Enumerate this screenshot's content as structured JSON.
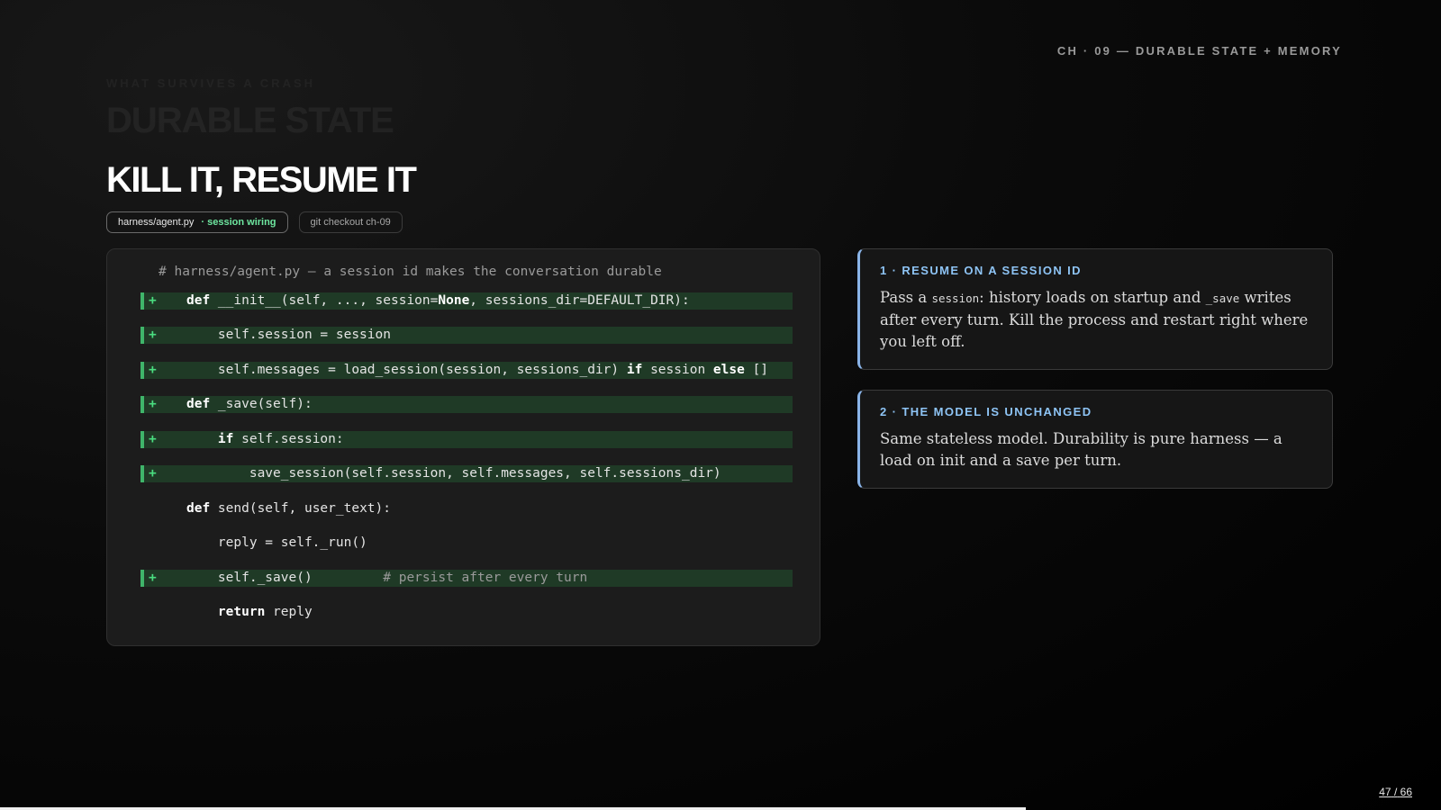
{
  "header": {
    "chapter": "CH · 09 — DURABLE STATE + MEMORY"
  },
  "background_slide": {
    "eyebrow": "WHAT SURVIVES A CRASH",
    "title": "DURABLE STATE"
  },
  "slide": {
    "title": "KILL IT, RESUME IT",
    "chips": {
      "file": "harness/agent.py",
      "file_note": "· session wiring",
      "git": "git checkout ch-09"
    }
  },
  "code": {
    "comment": "# harness/agent.py — a session id makes the conversation durable",
    "lines": [
      {
        "added": true,
        "marker": "+",
        "indent": "",
        "kw": "def",
        "text": " __init__(self, ..., session=",
        "kw2": "None",
        "rest": ", sessions_dir=DEFAULT_DIR):"
      },
      {
        "added": true,
        "marker": "+",
        "indent": "    ",
        "text": "self.session = session"
      },
      {
        "added": true,
        "marker": "+",
        "indent": "    ",
        "text": "self.messages = load_session(session, sessions_dir) ",
        "kw": "if",
        "mid": " session ",
        "kw2": "else",
        "rest": " []"
      },
      {
        "added": true,
        "marker": "+",
        "indent": "",
        "kw": "def",
        "text": " _save(self):"
      },
      {
        "added": true,
        "marker": "+",
        "indent": "    ",
        "kw": "if",
        "text": " self.session:"
      },
      {
        "added": true,
        "marker": "+",
        "indent": "        ",
        "text": "save_session(self.session, self.messages, self.sessions_dir)"
      },
      {
        "added": false,
        "marker": "",
        "indent": "",
        "kw": "def",
        "text": " send(self, user_text):"
      },
      {
        "added": false,
        "marker": "",
        "indent": "    ",
        "text": "reply = self._run()"
      },
      {
        "added": true,
        "marker": "+",
        "indent": "    ",
        "text": "self._save()         ",
        "comment": "# persist after every turn"
      },
      {
        "added": false,
        "marker": "",
        "indent": "    ",
        "kw": "return",
        "text": " reply"
      }
    ]
  },
  "cards": [
    {
      "label": "1 · RESUME ON A SESSION ID",
      "body_before": "Pass a ",
      "body_code": "session",
      "body_middle": ": history loads on startup and ",
      "body_code2": "_save",
      "body_after": " writes after every turn. Kill the process and restart right where you left off."
    },
    {
      "label": "2 · THE MODEL IS UNCHANGED",
      "body": "Same stateless model. Durability is pure harness — a load on init and a save per turn."
    }
  ],
  "pager": {
    "current": "47",
    "separator": "/",
    "total": "66",
    "progress_fraction": 0.712
  }
}
